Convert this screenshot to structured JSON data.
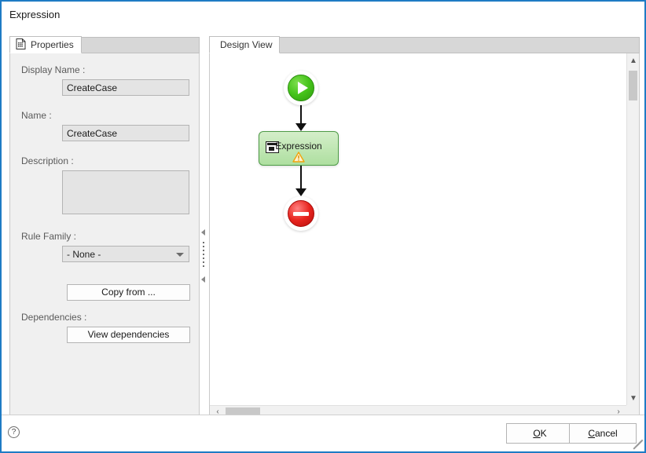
{
  "window": {
    "title": "Expression",
    "border_color": "#1e7bc4"
  },
  "left_panel": {
    "tab": {
      "label": "Properties",
      "icon": "properties-document-icon"
    },
    "fields": {
      "display_name": {
        "label": "Display Name :",
        "value": "CreateCase"
      },
      "name": {
        "label": "Name :",
        "value": "CreateCase"
      },
      "description": {
        "label": "Description :",
        "value": ""
      },
      "rule_family": {
        "label": "Rule Family :",
        "value": "- None -",
        "options": [
          "- None -"
        ]
      },
      "dependencies": {
        "label": "Dependencies :"
      }
    },
    "buttons": {
      "copy_from": "Copy from ...",
      "view_dependencies": "View dependencies"
    }
  },
  "right_panel": {
    "tab": {
      "label": "Design View"
    },
    "diagram": {
      "start_node": {
        "icon": "play-circle-icon",
        "color": "#39b412"
      },
      "task_node": {
        "label": "Expression",
        "icon": "expression-window-icon",
        "warning_icon": "warning-triangle-icon",
        "fill_color": "#bfe6b2",
        "border_color": "#4e9b47"
      },
      "end_node": {
        "icon": "stop-circle-icon",
        "color": "#e8251f"
      }
    },
    "scrollbars": {
      "up_arrow": "▲",
      "down_arrow": "▼",
      "left_arrow": "‹",
      "right_arrow": "›"
    }
  },
  "footer": {
    "help_icon": "help-question-icon",
    "ok": {
      "mnemonic": "O",
      "rest": "K"
    },
    "cancel": {
      "mnemonic": "C",
      "rest": "ancel"
    }
  }
}
